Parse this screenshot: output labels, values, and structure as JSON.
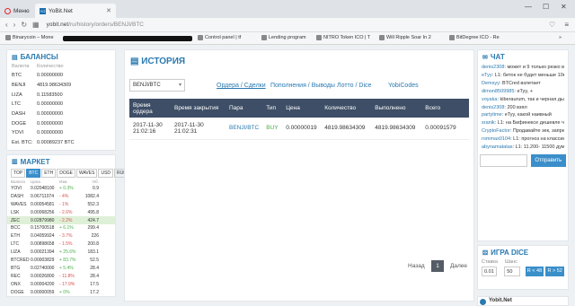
{
  "browser": {
    "tabs": [
      {
        "label": "Меню"
      },
      {
        "label": "YoBit.Net",
        "favicon": "YO"
      }
    ],
    "url_host": "yobit.net",
    "url_path": "/ru/history/orders/BENJI/BTC",
    "bookmarks": [
      "Binarycoin – Mone",
      "Control panel | tf",
      "Lending program",
      "NITRO Token ICO | T",
      "Will Ripple Soar In 2",
      "BitDegree ICO - Re"
    ]
  },
  "balances": {
    "title": "БАЛАНСЫ",
    "col_currency": "Валюта",
    "col_amount": "Количество",
    "rows": [
      {
        "cur": "BTC",
        "amt": "0.00000000"
      },
      {
        "cur": "BENJI",
        "amt": "4819.98634309"
      },
      {
        "cur": "LIZA",
        "amt": "0.11583500"
      },
      {
        "cur": "LTC",
        "amt": "0.00000000"
      },
      {
        "cur": "DASH",
        "amt": "0.00000000"
      },
      {
        "cur": "DOGE",
        "amt": "0.00000000"
      },
      {
        "cur": "YOVI",
        "amt": "0.00000000"
      },
      {
        "cur": "Est. BTC:",
        "amt": "0.00089237 BTC"
      }
    ]
  },
  "market": {
    "title": "МАРКЕТ",
    "tabs": [
      "TOP",
      "BTC",
      "ETH",
      "DOGE",
      "WAVES",
      "USD",
      "RUR"
    ],
    "active_tab": "BTC",
    "search_placeholder": "Поиск",
    "col_currency": "Валюта",
    "col_price": "Цена",
    "col_change": "Изм.",
    "col_volume": "Об.",
    "rows": [
      {
        "cur": "YOVI",
        "price": "0.02048100",
        "chg": "+ 0.3%",
        "vol": "0.9"
      },
      {
        "cur": "DASH",
        "price": "0.06711074",
        "chg": "- 4%",
        "vol": "1082.4"
      },
      {
        "cur": "WAVES",
        "price": "0.00054581",
        "chg": "- 1%",
        "vol": "552.3"
      },
      {
        "cur": "LSK",
        "price": "0.00068256",
        "chg": "- 2.6%",
        "vol": "495.8"
      },
      {
        "cur": "ZEC",
        "price": "0.02879980",
        "chg": "- 2.2%",
        "vol": "424.7"
      },
      {
        "cur": "BCC",
        "price": "0.15700518",
        "chg": "+ 6.1%",
        "vol": "299.4"
      },
      {
        "cur": "ETH",
        "price": "0.04059924",
        "chg": "- 3.7%",
        "vol": "226"
      },
      {
        "cur": "LTC",
        "price": "0.00898658",
        "chg": "- 1.5%",
        "vol": "200.8"
      },
      {
        "cur": "LIZA",
        "price": "0.00021394",
        "chg": "+ 25.6%",
        "vol": "183.1"
      },
      {
        "cur": "BTCRED",
        "price": "0.00003829",
        "chg": "+ 83.7%",
        "vol": "52.5"
      },
      {
        "cur": "BTG",
        "price": "0.02740000",
        "chg": "+ 5.4%",
        "vol": "28.4"
      },
      {
        "cur": "REC",
        "price": "0.00026800",
        "chg": "- 11.8%",
        "vol": "28.4"
      },
      {
        "cur": "ONX",
        "price": "0.00004200",
        "chg": "- 17.9%",
        "vol": "17.5"
      },
      {
        "cur": "DOGE",
        "price": "0.00000059",
        "chg": "+ 0%",
        "vol": "17.2"
      }
    ]
  },
  "history": {
    "title": "ИСТОРИЯ",
    "pair": "BENJI/BTC",
    "links": {
      "orders": "Ордера / Сделки",
      "deposits": "Пополнения / Выводы",
      "lotto": "Лотто / Dice",
      "yobicodes": "YobiCodes"
    },
    "columns": [
      "Время ордера",
      "Время закрытия",
      "Пара",
      "Тип",
      "Цена",
      "Количество",
      "Выполнено",
      "Всего"
    ],
    "rows": [
      {
        "order_time": "2017-11-30 21:02:16",
        "close_time": "2017-11-30 21:02:31",
        "pair": "BENJI/BTC",
        "type": "BUY",
        "price": "0.00000019",
        "amount": "4819.98634309",
        "done": "4819.98634309",
        "total": "0.00091579"
      }
    ],
    "pager": {
      "prev": "Назад",
      "page": "1",
      "next": "Далее"
    }
  },
  "chat": {
    "title": "ЧАТ",
    "messages": [
      {
        "user": "denis2308",
        "text": "может и 9 только резко вверх потом"
      },
      {
        "user": "eTyy",
        "text": "L1: биток не будет меньше 10к уже никогда"
      },
      {
        "user": "Demsyy",
        "text": "BTCred взлетает"
      },
      {
        "user": "dimon8509985",
        "text": "eTyy, +"
      },
      {
        "user": "voyaka",
        "text": "kiberaurum, так и черная дыра может открыться"
      },
      {
        "user": "denis2308",
        "text": "200 взял"
      },
      {
        "user": "partytime",
        "text": "eTyy, какой наивный"
      },
      {
        "user": "sranik",
        "text": "L1: на Бифинексе дешевле чем у нас стало"
      },
      {
        "user": "CryptoFactor",
        "text": "Продавайте зек, запрещать его будут!"
      },
      {
        "user": "rommax0104",
        "text": "L1: прогноз на классик кто знает?"
      },
      {
        "user": "abynamatatas",
        "text": "L1: 11.200- 11500 думаю"
      }
    ],
    "send_label": "Отправить"
  },
  "dice": {
    "title": "ИГРА DICE",
    "bet_label": "Ставка",
    "chance_label": "Шанс",
    "bet_value": "0.01",
    "chance_value": "50",
    "btn_low": "R < 48",
    "btn_high": "R > 52"
  },
  "footer": {
    "site": "Yobit.Net"
  },
  "colors": {
    "accent": "#2a7ab0",
    "table_header": "#3d4e66",
    "buy": "#4cae4c",
    "sell": "#d9534f"
  }
}
